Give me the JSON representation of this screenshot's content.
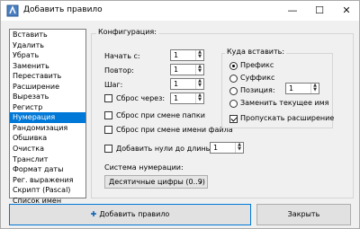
{
  "window": {
    "title": "Добавить правило"
  },
  "rules": {
    "items": [
      "Вставить",
      "Удалить",
      "Убрать",
      "Заменить",
      "Переставить",
      "Расширение",
      "Вырезать",
      "Регистр",
      "Нумерация",
      "Рандомизация",
      "Обшивка",
      "Очистка",
      "Транслит",
      "Формат даты",
      "Рег. выражения",
      "Скрипт (Pascal)",
      "Список имен"
    ],
    "selected": "Нумерация"
  },
  "config": {
    "title": "Конфигурация:",
    "start_label": "Начать с:",
    "start_value": "1",
    "step_label": "Повтор:",
    "step_value": "1",
    "increment_label": "Шаг:",
    "increment_value": "1",
    "reset_every_label": "Сброс через:",
    "reset_every_value": "1",
    "reset_every_checked": false,
    "reset_folder_label": "Сброс при смене папки",
    "reset_folder_checked": false,
    "reset_name_label": "Сброс при смене имени файла",
    "reset_name_checked": false,
    "pad_zeros_label": "Добавить нули до длины:",
    "pad_zeros_value": "1",
    "pad_zeros_checked": false,
    "system_label": "Система нумерации:",
    "system_value": "Десятичные цифры (0..9)"
  },
  "insert": {
    "title": "Куда вставить:",
    "prefix": "Префикс",
    "suffix": "Суффикс",
    "position": "Позиция:",
    "position_value": "1",
    "replace_name": "Заменить текущее имя",
    "selected": "prefix",
    "skip_extension": "Пропускать расширение",
    "skip_extension_checked": true
  },
  "buttons": {
    "add": "Добавить правило",
    "close": "Закрыть"
  },
  "icons": {
    "app": "app-icon",
    "add": "plus-icon"
  }
}
